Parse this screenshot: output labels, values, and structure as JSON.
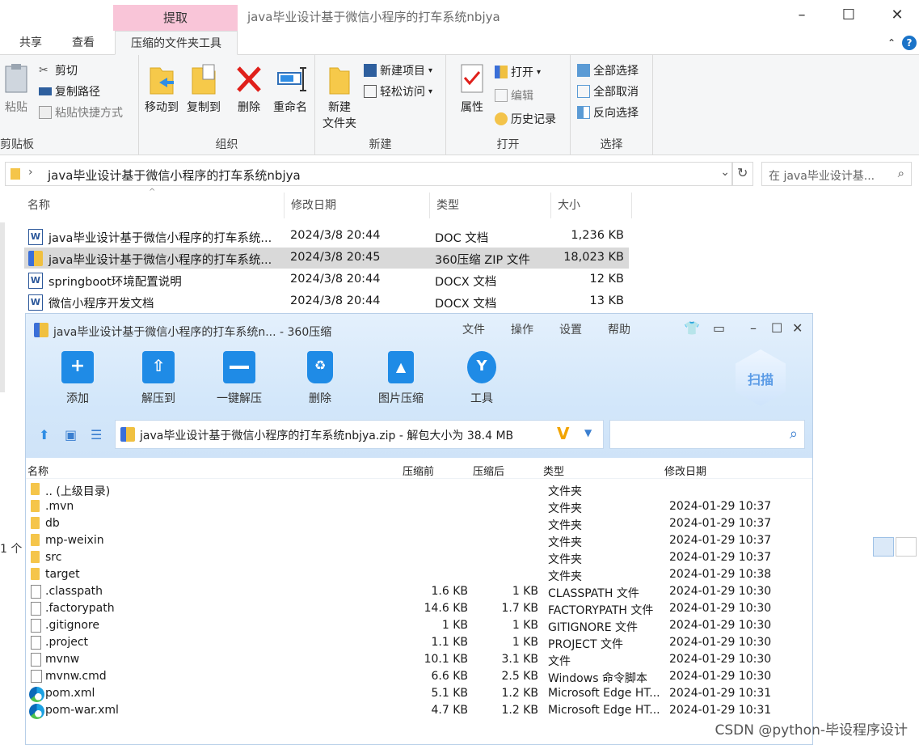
{
  "explorer": {
    "context_tab": "提取",
    "title": "java毕业设计基于微信小程序的打车系统nbjya",
    "ribbon_tabs": [
      "共享",
      "查看",
      "压缩的文件夹工具"
    ],
    "clipboard": {
      "paste": "粘贴",
      "cut": "剪切",
      "copy_path": "复制路径",
      "paste_shortcut": "粘贴快捷方式",
      "label": "剪贴板"
    },
    "organize": {
      "move_to": "移动到",
      "copy_to": "复制到",
      "delete": "删除",
      "rename": "重命名",
      "label": "组织"
    },
    "new": {
      "new_folder_line1": "新建",
      "new_folder_line2": "文件夹",
      "new_item": "新建项目",
      "easy_access": "轻松访问",
      "label": "新建"
    },
    "open": {
      "properties": "属性",
      "open": "打开",
      "edit": "编辑",
      "history": "历史记录",
      "label": "打开"
    },
    "select": {
      "select_all": "全部选择",
      "select_none": "全部取消",
      "invert": "反向选择",
      "label": "选择"
    },
    "address": "java毕业设计基于微信小程序的打车系统nbjya",
    "search_placeholder": "在 java毕业设计基...",
    "columns": {
      "name": "名称",
      "modified": "修改日期",
      "type": "类型",
      "size": "大小"
    },
    "files": [
      {
        "name": "java毕业设计基于微信小程序的打车系统...",
        "modified": "2024/3/8 20:44",
        "type": "DOC 文档",
        "size": "1,236 KB",
        "icon": "word-icon",
        "selected": false
      },
      {
        "name": "java毕业设计基于微信小程序的打车系统...",
        "modified": "2024/3/8 20:45",
        "type": "360压缩 ZIP 文件",
        "size": "18,023 KB",
        "icon": "zip-icon",
        "selected": true
      },
      {
        "name": "springboot环境配置说明",
        "modified": "2024/3/8 20:44",
        "type": "DOCX 文档",
        "size": "12 KB",
        "icon": "word-icon",
        "selected": false
      },
      {
        "name": "微信小程序开发文档",
        "modified": "2024/3/8 20:44",
        "type": "DOCX 文档",
        "size": "13 KB",
        "icon": "word-icon",
        "selected": false
      }
    ],
    "status": "1 个"
  },
  "zip": {
    "title": "java毕业设计基于微信小程序的打车系统n... - 360压缩",
    "menu": [
      "文件",
      "操作",
      "设置",
      "帮助"
    ],
    "tools": [
      "添加",
      "解压到",
      "一键解压",
      "删除",
      "图片压缩",
      "工具"
    ],
    "scan": "扫描",
    "path": "java毕业设计基于微信小程序的打车系统nbjya.zip - 解包大小为 38.4 MB",
    "columns": {
      "name": "名称",
      "before": "压缩前",
      "after": "压缩后",
      "type": "类型",
      "modified": "修改日期"
    },
    "rows": [
      {
        "name": ".. (上级目录)",
        "before": "",
        "after": "",
        "type": "文件夹",
        "modified": "",
        "icon": "folder"
      },
      {
        "name": ".mvn",
        "before": "",
        "after": "",
        "type": "文件夹",
        "modified": "2024-01-29 10:37",
        "icon": "folder"
      },
      {
        "name": "db",
        "before": "",
        "after": "",
        "type": "文件夹",
        "modified": "2024-01-29 10:37",
        "icon": "folder"
      },
      {
        "name": "mp-weixin",
        "before": "",
        "after": "",
        "type": "文件夹",
        "modified": "2024-01-29 10:37",
        "icon": "folder"
      },
      {
        "name": "src",
        "before": "",
        "after": "",
        "type": "文件夹",
        "modified": "2024-01-29 10:37",
        "icon": "folder"
      },
      {
        "name": "target",
        "before": "",
        "after": "",
        "type": "文件夹",
        "modified": "2024-01-29 10:38",
        "icon": "folder"
      },
      {
        "name": ".classpath",
        "before": "1.6 KB",
        "after": "1 KB",
        "type": "CLASSPATH 文件",
        "modified": "2024-01-29 10:30",
        "icon": "file"
      },
      {
        "name": ".factorypath",
        "before": "14.6 KB",
        "after": "1.7 KB",
        "type": "FACTORYPATH 文件",
        "modified": "2024-01-29 10:30",
        "icon": "file"
      },
      {
        "name": ".gitignore",
        "before": "1 KB",
        "after": "1 KB",
        "type": "GITIGNORE 文件",
        "modified": "2024-01-29 10:30",
        "icon": "file"
      },
      {
        "name": ".project",
        "before": "1.1 KB",
        "after": "1 KB",
        "type": "PROJECT 文件",
        "modified": "2024-01-29 10:30",
        "icon": "file"
      },
      {
        "name": "mvnw",
        "before": "10.1 KB",
        "after": "3.1 KB",
        "type": "文件",
        "modified": "2024-01-29 10:30",
        "icon": "file"
      },
      {
        "name": "mvnw.cmd",
        "before": "6.6 KB",
        "after": "2.5 KB",
        "type": "Windows 命令脚本",
        "modified": "2024-01-29 10:30",
        "icon": "cmd"
      },
      {
        "name": "pom.xml",
        "before": "5.1 KB",
        "after": "1.2 KB",
        "type": "Microsoft Edge HT...",
        "modified": "2024-01-29 10:31",
        "icon": "edge"
      },
      {
        "name": "pom-war.xml",
        "before": "4.7 KB",
        "after": "1.2 KB",
        "type": "Microsoft Edge HT...",
        "modified": "2024-01-29 10:31",
        "icon": "edge"
      }
    ]
  },
  "watermark": "CSDN @python-毕设程序设计"
}
